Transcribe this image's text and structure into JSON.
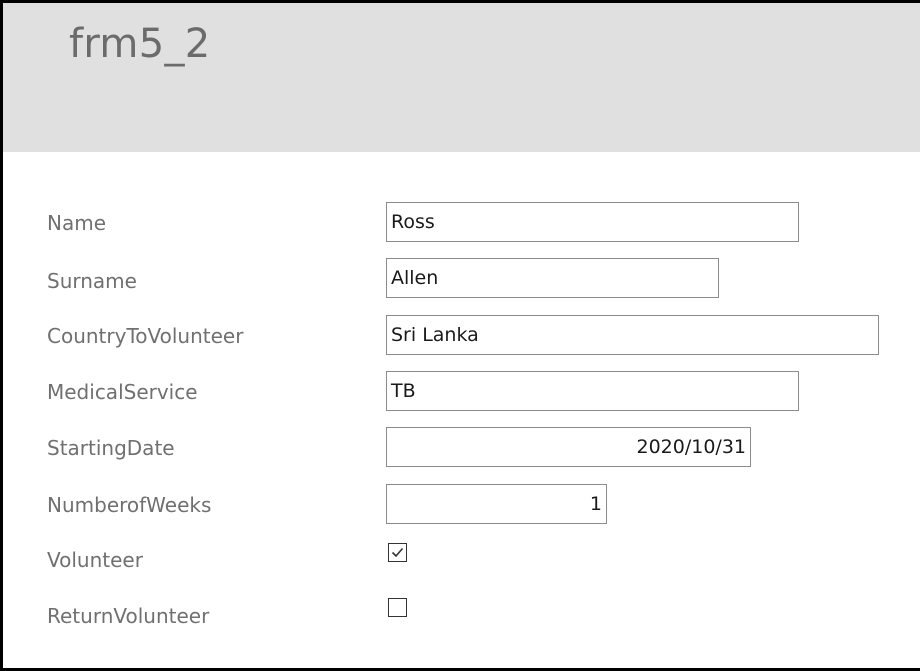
{
  "form": {
    "title": "frm5_2"
  },
  "fields": {
    "name": {
      "label": "Name",
      "value": "Ross"
    },
    "surname": {
      "label": "Surname",
      "value": "Allen"
    },
    "country": {
      "label": "CountryToVolunteer",
      "value": "Sri Lanka"
    },
    "medical_service": {
      "label": "MedicalService",
      "value": "TB"
    },
    "starting_date": {
      "label": "StartingDate",
      "value": "2020/10/31"
    },
    "number_of_weeks": {
      "label": "NumberofWeeks",
      "value": "1"
    },
    "volunteer": {
      "label": "Volunteer",
      "checked": true
    },
    "return_volunteer": {
      "label": "ReturnVolunteer",
      "checked": false
    }
  }
}
